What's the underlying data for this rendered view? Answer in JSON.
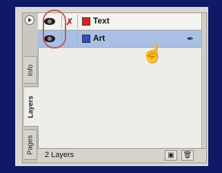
{
  "panel": {
    "tabs": [
      {
        "label": "Info"
      },
      {
        "label": "Layers"
      },
      {
        "label": "Pages"
      }
    ],
    "layers": [
      {
        "name": "Text",
        "color": "#e02020",
        "visible": true,
        "locked": true
      },
      {
        "name": "Art",
        "color": "#2a4ecc",
        "visible": true,
        "locked": false,
        "selected": true
      }
    ],
    "footer": {
      "count_label": "2 Layers"
    }
  },
  "icons": {
    "visibility": "eye-icon",
    "lock": "pencil-lock-icon",
    "pen": "pen-tool-icon",
    "cursor": "hand-pointer-icon",
    "new_layer": "new-layer-icon",
    "trash": "trash-icon"
  }
}
